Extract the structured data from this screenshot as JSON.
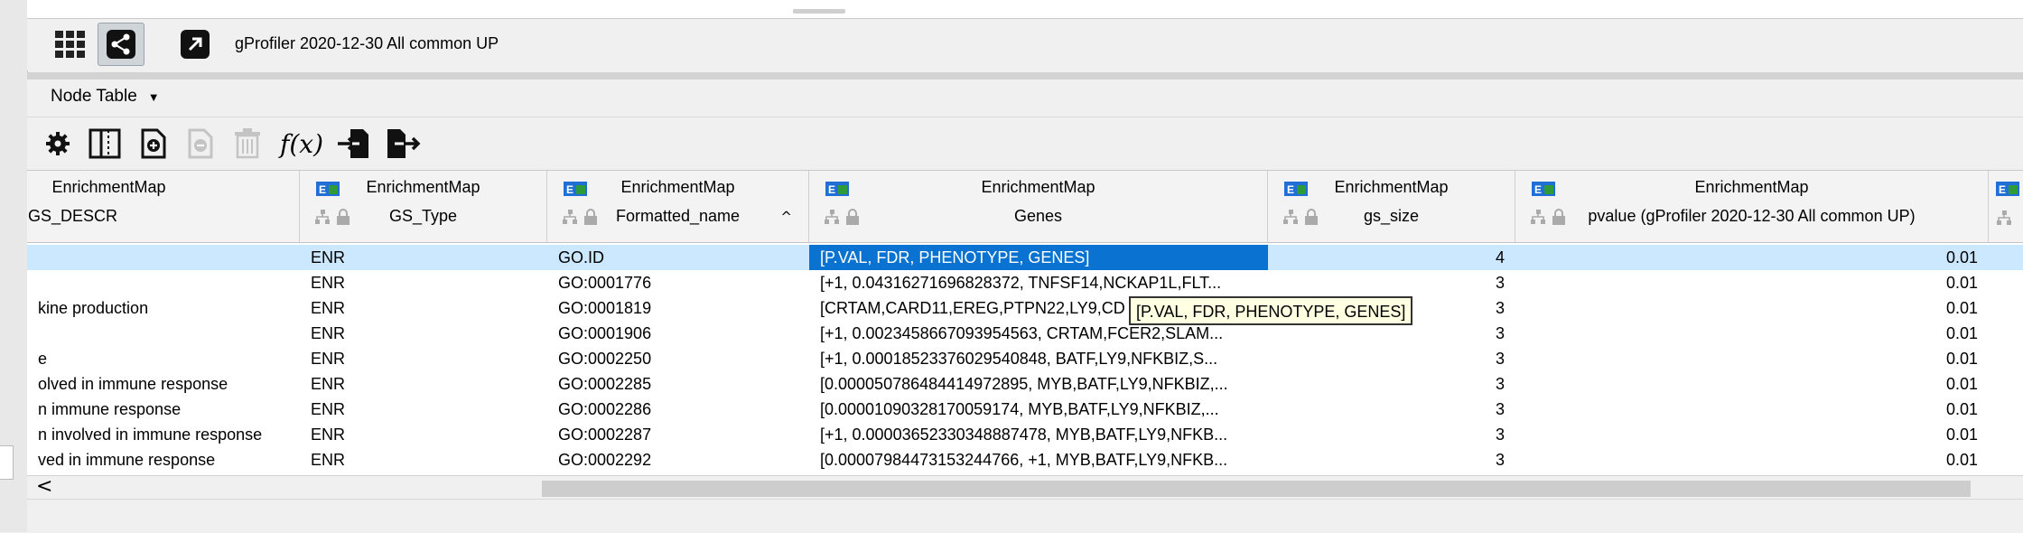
{
  "network": {
    "title": "gProfiler 2020-12-30 All common UP"
  },
  "panel": {
    "title": "Node Table"
  },
  "columns": [
    {
      "ns": "EnrichmentMap",
      "name": "GS_DESCR"
    },
    {
      "ns": "EnrichmentMap",
      "name": "GS_Type"
    },
    {
      "ns": "EnrichmentMap",
      "name": "Formatted_name",
      "sort": "^"
    },
    {
      "ns": "EnrichmentMap",
      "name": "Genes"
    },
    {
      "ns": "EnrichmentMap",
      "name": "gs_size"
    },
    {
      "ns": "EnrichmentMap",
      "name": "pvalue (gProfiler 2020-12-30 All common UP)"
    }
  ],
  "rows": [
    {
      "descr": "",
      "type": "ENR",
      "fname": "GO.ID",
      "genes": "[P.VAL, FDR, PHENOTYPE, GENES]",
      "size": "4",
      "pvalue": "0.01"
    },
    {
      "descr": "",
      "type": "ENR",
      "fname": "GO:0001776",
      "genes": "[+1, 0.04316271696828372, TNFSF14,NCKAP1L,FLT...",
      "size": "3",
      "pvalue": "0.01"
    },
    {
      "descr": "kine production",
      "type": "ENR",
      "fname": "GO:0001819",
      "genes": "[CRTAM,CARD11,EREG,PTPN22,LY9,CD",
      "size": "3",
      "pvalue": "0.01"
    },
    {
      "descr": "",
      "type": "ENR",
      "fname": "GO:0001906",
      "genes": "[+1, 0.0023458667093954563, CRTAM,FCER2,SLAM...",
      "size": "3",
      "pvalue": "0.01"
    },
    {
      "descr": "e",
      "type": "ENR",
      "fname": "GO:0002250",
      "genes": "[+1, 0.00018523376029540848, BATF,LY9,NFKBIZ,S...",
      "size": "3",
      "pvalue": "0.01"
    },
    {
      "descr": "olved in immune response",
      "type": "ENR",
      "fname": "GO:0002285",
      "genes": "[0.000050786484414972895, MYB,BATF,LY9,NFKBIZ,...",
      "size": "3",
      "pvalue": "0.01"
    },
    {
      "descr": "n immune response",
      "type": "ENR",
      "fname": "GO:0002286",
      "genes": "[0.00001090328170059174, MYB,BATF,LY9,NFKBIZ,...",
      "size": "3",
      "pvalue": "0.01"
    },
    {
      "descr": "n involved in immune response",
      "type": "ENR",
      "fname": "GO:0002287",
      "genes": "[+1, 0.00003652330348887478, MYB,BATF,LY9,NFKB...",
      "size": "3",
      "pvalue": "0.01"
    },
    {
      "descr": "ved in immune response",
      "type": "ENR",
      "fname": "GO:0002292",
      "genes": "[0.00007984473153244766, +1, MYB,BATF,LY9,NFKB...",
      "size": "3",
      "pvalue": "0.01"
    }
  ],
  "tooltip": {
    "text": "[P.VAL, FDR, PHENOTYPE, GENES]"
  },
  "scroll": {
    "left_arrow": "<"
  },
  "icons": {
    "settings": "gear-icon",
    "columns": "columns-icon",
    "add": "add-column-icon",
    "remove": "remove-column-icon",
    "delete": "delete-icon",
    "function": "f(x)",
    "import": "import-table-icon",
    "export": "export-table-icon"
  },
  "colors": {
    "selection": "#cce8ff",
    "selected_cell": "#0a73d1",
    "em_icon_blue": "#1f6fd6",
    "em_icon_green": "#2e9a3a"
  }
}
